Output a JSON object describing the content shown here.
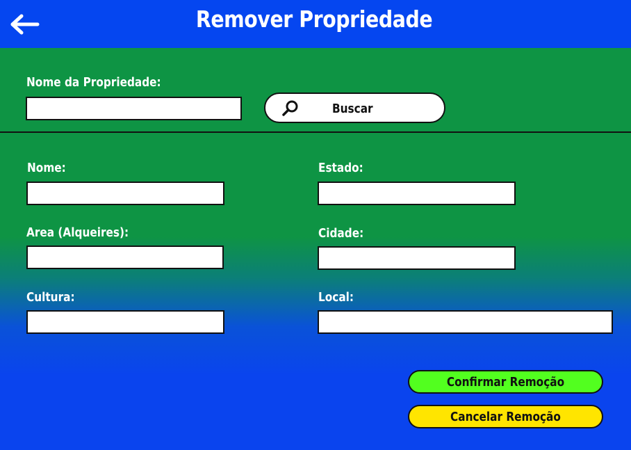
{
  "header": {
    "title": "Remover Propriedade",
    "back_icon": "arrow-left-icon",
    "color": "#0546f0"
  },
  "search": {
    "label": "Nome da Propriedade:",
    "value": "",
    "button_label": "Buscar",
    "button_icon": "search-icon"
  },
  "form": {
    "nome": {
      "label": "Nome:",
      "value": ""
    },
    "area": {
      "label": "Area (Alqueires):",
      "value": ""
    },
    "cultura": {
      "label": "Cultura:",
      "value": ""
    },
    "estado": {
      "label": "Estado:",
      "value": ""
    },
    "cidade": {
      "label": "Cidade:",
      "value": ""
    },
    "local": {
      "label": "Local:",
      "value": ""
    }
  },
  "actions": {
    "confirm_label": "Confirmar Remoção",
    "confirm_color": "#52ff1f",
    "cancel_label": "Cancelar Remoção",
    "cancel_color": "#ffe500"
  },
  "colors": {
    "green_panel": "#0e9444",
    "blue_bottom": "#0a44ee"
  }
}
